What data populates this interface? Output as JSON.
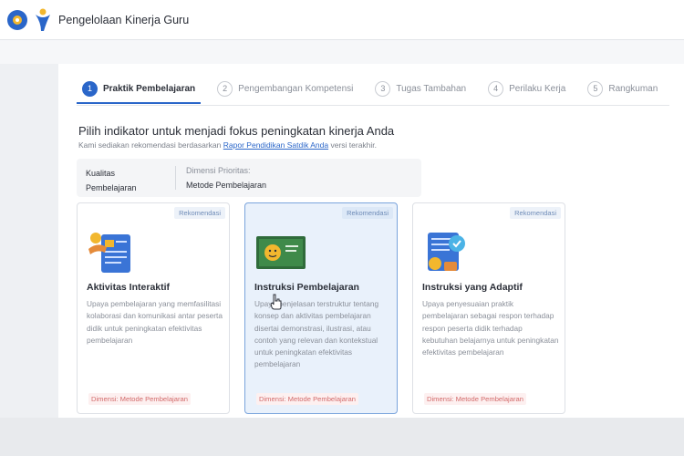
{
  "app": {
    "title": "Pengelolaan Kinerja Guru"
  },
  "stepper": {
    "steps": [
      {
        "num": "1",
        "label": "Praktik Pembelajaran"
      },
      {
        "num": "2",
        "label": "Pengembangan Kompetensi"
      },
      {
        "num": "3",
        "label": "Tugas Tambahan"
      },
      {
        "num": "4",
        "label": "Perilaku Kerja"
      },
      {
        "num": "5",
        "label": "Rangkuman"
      }
    ]
  },
  "content": {
    "heading": "Pilih indikator untuk menjadi fokus peningkatan kinerja Anda",
    "sub_before": "Kami sediakan rekomendasi berdasarkan",
    "sub_link": "Rapor Pendidikan Satdik Anda",
    "sub_after": "versi terakhir."
  },
  "info": {
    "key_line1": "Kualitas",
    "key_line2": "Pembelajaran",
    "dim_label": "Dimensi Prioritas:",
    "dim_value": "Metode Pembelajaran"
  },
  "cards": [
    {
      "badge": "Rekomendasi",
      "title": "Aktivitas Interaktif",
      "description": "Upaya pembelajaran yang memfasilitasi kolaborasi dan komunikasi antar peserta didik untuk peningkatan efektivitas pembelajaran",
      "tag": "Dimensi: Metode Pembelajaran"
    },
    {
      "badge": "Rekomendasi",
      "title": "Instruksi Pembelajaran",
      "description": "Upaya penjelasan terstruktur tentang konsep dan aktivitas pembelajaran disertai demonstrasi, ilustrasi, atau contoh yang relevan dan kontekstual untuk peningkatan efektivitas pembelajaran",
      "tag": "Dimensi: Metode Pembelajaran"
    },
    {
      "badge": "Rekomendasi",
      "title": "Instruksi yang Adaptif",
      "description": "Upaya penyesuaian praktik pembelajaran sebagai respon terhadap respon peserta didik terhadap kebutuhan belajarnya untuk peningkatan efektivitas pembelajaran",
      "tag": "Dimensi: Metode Pembelajaran"
    }
  ],
  "colors": {
    "primary": "#2a66c9",
    "selected_bg": "#e9f1fb",
    "tag_red": "#d26a6a"
  },
  "icons": [
    "logo-circle-icon",
    "tut-wuri-figure-icon",
    "cursor-hand-icon"
  ]
}
